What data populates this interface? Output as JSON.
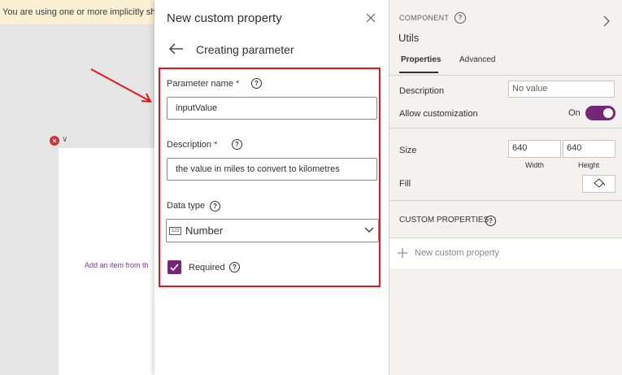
{
  "banner": {
    "text": "You are using one or more implicitly sha"
  },
  "canvas": {
    "hint": "Add an item from th",
    "error_glyph": "×",
    "chevron_glyph": "∨"
  },
  "panel": {
    "title": "New custom property",
    "subtitle": "Creating parameter",
    "fields": {
      "name_label": "Parameter name",
      "name_value": "inputValue",
      "description_label": "Description",
      "description_value": "the value in miles to convert to kilometres",
      "datatype_label": "Data type",
      "datatype_value": "Number",
      "datatype_icon_text": "123",
      "required_label": "Required",
      "required_checked": true
    },
    "required_marker": "*",
    "help_glyph": "?"
  },
  "props": {
    "component_label": "COMPONENT",
    "component_name": "Utils",
    "tabs": [
      "Properties",
      "Advanced"
    ],
    "active_tab": "Properties",
    "description_label": "Description",
    "description_placeholder": "No value",
    "allow_customization_label": "Allow customization",
    "toggle_state": "On",
    "size_label": "Size",
    "width_value": "640",
    "height_value": "640",
    "width_caption": "Width",
    "height_caption": "Height",
    "fill_label": "Fill",
    "custom_properties_heading": "CUSTOM PROPERTIES",
    "new_property_label": "New custom property"
  },
  "colors": {
    "accent": "#742774",
    "highlight": "#e8161a",
    "error": "#d13438",
    "banner": "#fcf0d2"
  },
  "icons": [
    "close-icon",
    "back-arrow-icon",
    "help-icon",
    "number-icon",
    "chevron-down-icon",
    "checkmark-icon",
    "chevron-right-icon",
    "plus-icon",
    "paint-bucket-icon",
    "error-icon"
  ]
}
